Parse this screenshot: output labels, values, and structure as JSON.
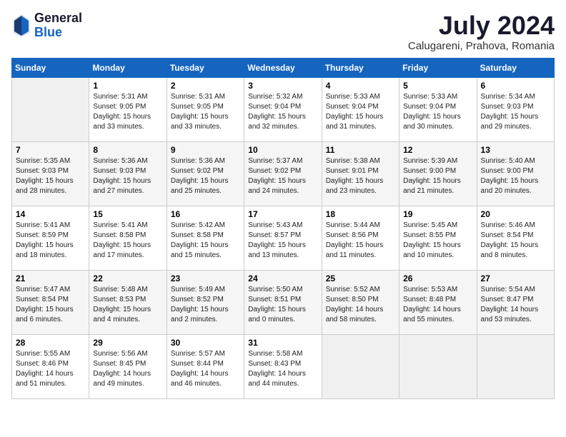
{
  "header": {
    "logo_general": "General",
    "logo_blue": "Blue",
    "month_year": "July 2024",
    "location": "Calugareni, Prahova, Romania"
  },
  "weekdays": [
    "Sunday",
    "Monday",
    "Tuesday",
    "Wednesday",
    "Thursday",
    "Friday",
    "Saturday"
  ],
  "weeks": [
    [
      {
        "day": "",
        "empty": true
      },
      {
        "day": "1",
        "sunrise": "Sunrise: 5:31 AM",
        "sunset": "Sunset: 9:05 PM",
        "daylight": "Daylight: 15 hours and 33 minutes."
      },
      {
        "day": "2",
        "sunrise": "Sunrise: 5:31 AM",
        "sunset": "Sunset: 9:05 PM",
        "daylight": "Daylight: 15 hours and 33 minutes."
      },
      {
        "day": "3",
        "sunrise": "Sunrise: 5:32 AM",
        "sunset": "Sunset: 9:04 PM",
        "daylight": "Daylight: 15 hours and 32 minutes."
      },
      {
        "day": "4",
        "sunrise": "Sunrise: 5:33 AM",
        "sunset": "Sunset: 9:04 PM",
        "daylight": "Daylight: 15 hours and 31 minutes."
      },
      {
        "day": "5",
        "sunrise": "Sunrise: 5:33 AM",
        "sunset": "Sunset: 9:04 PM",
        "daylight": "Daylight: 15 hours and 30 minutes."
      },
      {
        "day": "6",
        "sunrise": "Sunrise: 5:34 AM",
        "sunset": "Sunset: 9:03 PM",
        "daylight": "Daylight: 15 hours and 29 minutes."
      }
    ],
    [
      {
        "day": "7",
        "sunrise": "Sunrise: 5:35 AM",
        "sunset": "Sunset: 9:03 PM",
        "daylight": "Daylight: 15 hours and 28 minutes."
      },
      {
        "day": "8",
        "sunrise": "Sunrise: 5:36 AM",
        "sunset": "Sunset: 9:03 PM",
        "daylight": "Daylight: 15 hours and 27 minutes."
      },
      {
        "day": "9",
        "sunrise": "Sunrise: 5:36 AM",
        "sunset": "Sunset: 9:02 PM",
        "daylight": "Daylight: 15 hours and 25 minutes."
      },
      {
        "day": "10",
        "sunrise": "Sunrise: 5:37 AM",
        "sunset": "Sunset: 9:02 PM",
        "daylight": "Daylight: 15 hours and 24 minutes."
      },
      {
        "day": "11",
        "sunrise": "Sunrise: 5:38 AM",
        "sunset": "Sunset: 9:01 PM",
        "daylight": "Daylight: 15 hours and 23 minutes."
      },
      {
        "day": "12",
        "sunrise": "Sunrise: 5:39 AM",
        "sunset": "Sunset: 9:00 PM",
        "daylight": "Daylight: 15 hours and 21 minutes."
      },
      {
        "day": "13",
        "sunrise": "Sunrise: 5:40 AM",
        "sunset": "Sunset: 9:00 PM",
        "daylight": "Daylight: 15 hours and 20 minutes."
      }
    ],
    [
      {
        "day": "14",
        "sunrise": "Sunrise: 5:41 AM",
        "sunset": "Sunset: 8:59 PM",
        "daylight": "Daylight: 15 hours and 18 minutes."
      },
      {
        "day": "15",
        "sunrise": "Sunrise: 5:41 AM",
        "sunset": "Sunset: 8:58 PM",
        "daylight": "Daylight: 15 hours and 17 minutes."
      },
      {
        "day": "16",
        "sunrise": "Sunrise: 5:42 AM",
        "sunset": "Sunset: 8:58 PM",
        "daylight": "Daylight: 15 hours and 15 minutes."
      },
      {
        "day": "17",
        "sunrise": "Sunrise: 5:43 AM",
        "sunset": "Sunset: 8:57 PM",
        "daylight": "Daylight: 15 hours and 13 minutes."
      },
      {
        "day": "18",
        "sunrise": "Sunrise: 5:44 AM",
        "sunset": "Sunset: 8:56 PM",
        "daylight": "Daylight: 15 hours and 11 minutes."
      },
      {
        "day": "19",
        "sunrise": "Sunrise: 5:45 AM",
        "sunset": "Sunset: 8:55 PM",
        "daylight": "Daylight: 15 hours and 10 minutes."
      },
      {
        "day": "20",
        "sunrise": "Sunrise: 5:46 AM",
        "sunset": "Sunset: 8:54 PM",
        "daylight": "Daylight: 15 hours and 8 minutes."
      }
    ],
    [
      {
        "day": "21",
        "sunrise": "Sunrise: 5:47 AM",
        "sunset": "Sunset: 8:54 PM",
        "daylight": "Daylight: 15 hours and 6 minutes."
      },
      {
        "day": "22",
        "sunrise": "Sunrise: 5:48 AM",
        "sunset": "Sunset: 8:53 PM",
        "daylight": "Daylight: 15 hours and 4 minutes."
      },
      {
        "day": "23",
        "sunrise": "Sunrise: 5:49 AM",
        "sunset": "Sunset: 8:52 PM",
        "daylight": "Daylight: 15 hours and 2 minutes."
      },
      {
        "day": "24",
        "sunrise": "Sunrise: 5:50 AM",
        "sunset": "Sunset: 8:51 PM",
        "daylight": "Daylight: 15 hours and 0 minutes."
      },
      {
        "day": "25",
        "sunrise": "Sunrise: 5:52 AM",
        "sunset": "Sunset: 8:50 PM",
        "daylight": "Daylight: 14 hours and 58 minutes."
      },
      {
        "day": "26",
        "sunrise": "Sunrise: 5:53 AM",
        "sunset": "Sunset: 8:48 PM",
        "daylight": "Daylight: 14 hours and 55 minutes."
      },
      {
        "day": "27",
        "sunrise": "Sunrise: 5:54 AM",
        "sunset": "Sunset: 8:47 PM",
        "daylight": "Daylight: 14 hours and 53 minutes."
      }
    ],
    [
      {
        "day": "28",
        "sunrise": "Sunrise: 5:55 AM",
        "sunset": "Sunset: 8:46 PM",
        "daylight": "Daylight: 14 hours and 51 minutes."
      },
      {
        "day": "29",
        "sunrise": "Sunrise: 5:56 AM",
        "sunset": "Sunset: 8:45 PM",
        "daylight": "Daylight: 14 hours and 49 minutes."
      },
      {
        "day": "30",
        "sunrise": "Sunrise: 5:57 AM",
        "sunset": "Sunset: 8:44 PM",
        "daylight": "Daylight: 14 hours and 46 minutes."
      },
      {
        "day": "31",
        "sunrise": "Sunrise: 5:58 AM",
        "sunset": "Sunset: 8:43 PM",
        "daylight": "Daylight: 14 hours and 44 minutes."
      },
      {
        "day": "",
        "empty": true
      },
      {
        "day": "",
        "empty": true
      },
      {
        "day": "",
        "empty": true
      }
    ]
  ]
}
